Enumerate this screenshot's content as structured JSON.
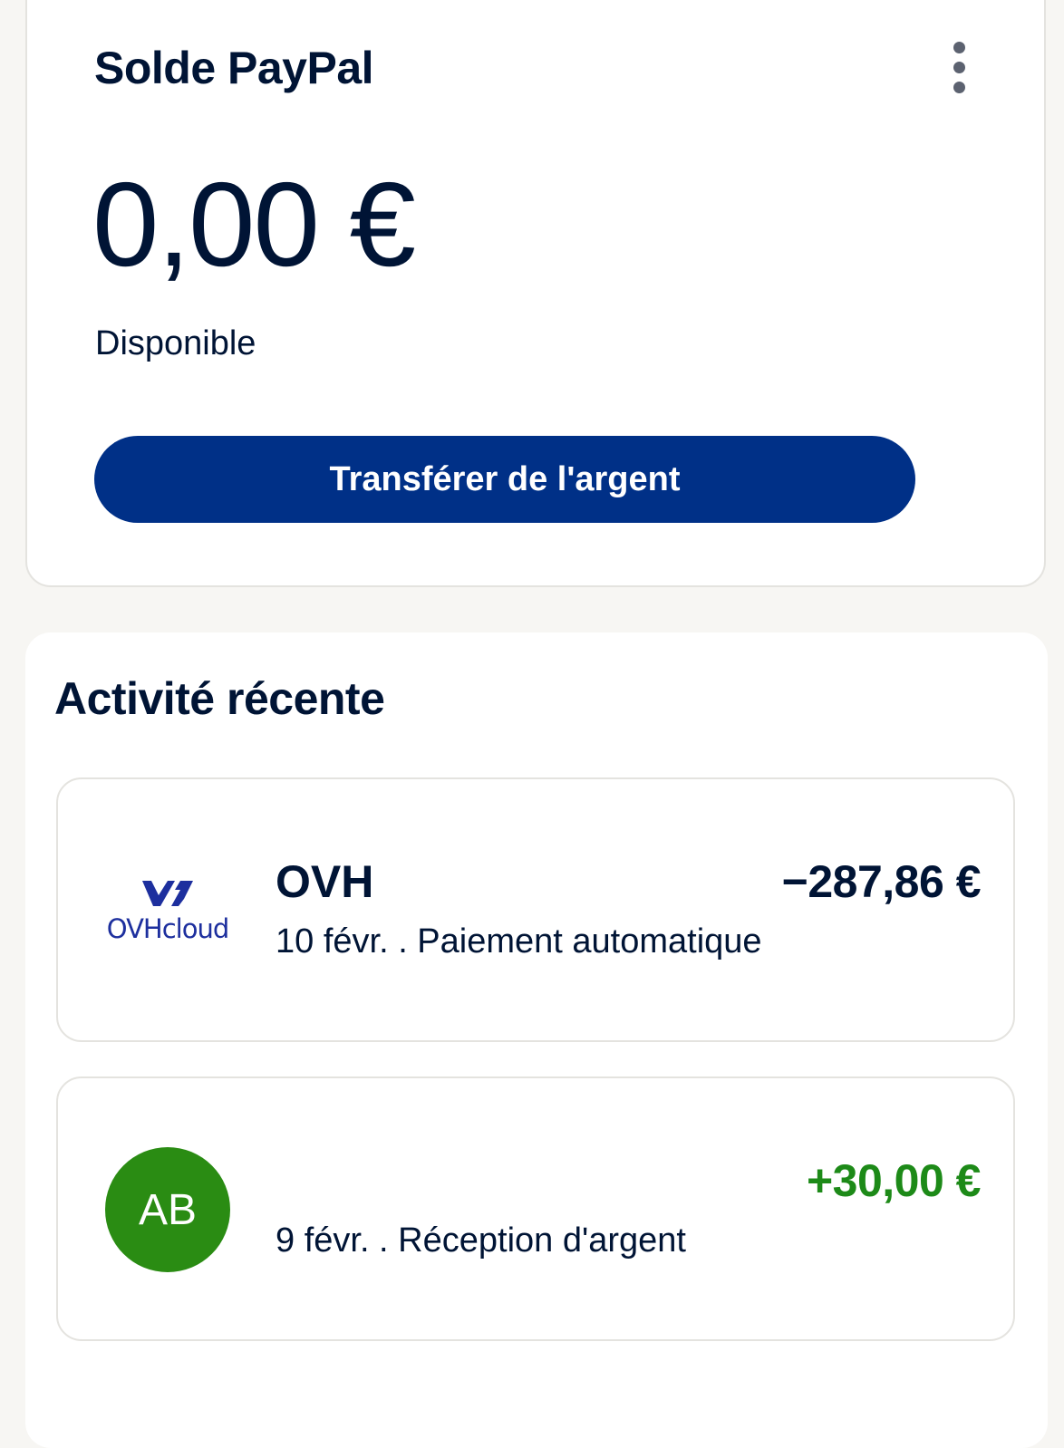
{
  "balance": {
    "title": "Solde PayPal",
    "amount": "0,00 €",
    "subtitle": "Disponible",
    "transfer_label": "Transférer de l'argent"
  },
  "activity": {
    "title": "Activité récente",
    "transactions": [
      {
        "name": "OVH",
        "logo_text": "OVHcloud",
        "amount": "−287,86 €",
        "description": "10 févr. . Paiement automatique"
      },
      {
        "name": "",
        "initials": "AB",
        "amount": "+30,00 €",
        "description": "9 févr. . Réception d'argent"
      }
    ]
  },
  "colors": {
    "primary": "#003087",
    "text": "#001435",
    "positive": "#1d8a18",
    "avatar": "#2a8c13",
    "ovh_brand": "#1d2f9e"
  }
}
